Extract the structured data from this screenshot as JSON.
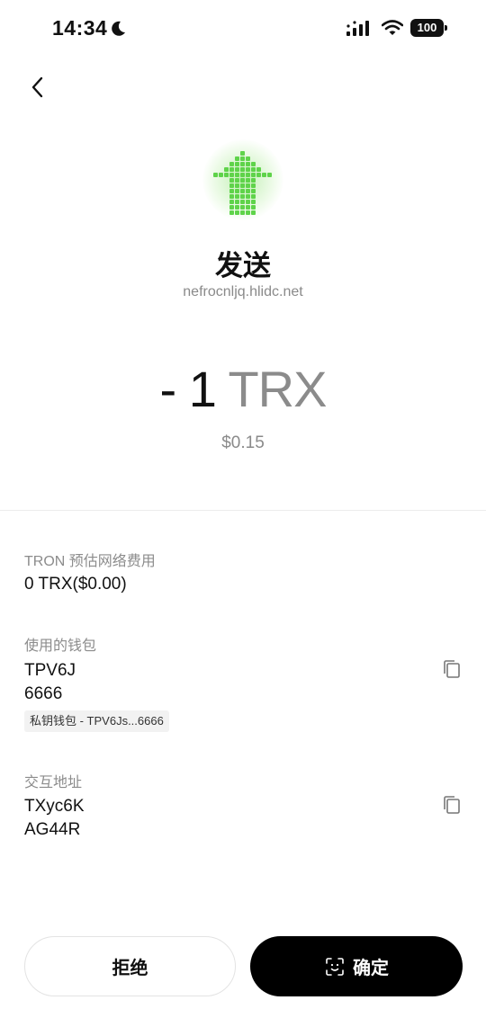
{
  "status_bar": {
    "time": "14:34",
    "battery": "100"
  },
  "transaction": {
    "type": "发送",
    "dapp_domain": "nefrocnljq.hlidc.net",
    "amount_value": "- 1",
    "amount_unit": "TRX",
    "fiat_value": "$0.15"
  },
  "fee": {
    "label": "TRON 预估网络费用",
    "value": "0 TRX($0.00)"
  },
  "wallet": {
    "label": "使用的钱包",
    "address_line1": "TPV6J",
    "address_line2": "6666",
    "tag": "私钥钱包 - TPV6Js...6666"
  },
  "interaction": {
    "label": "交互地址",
    "address_line1": "TXyc6K",
    "address_line2": "AG44R"
  },
  "actions": {
    "reject_label": "拒绝",
    "confirm_label": "确定"
  },
  "colors": {
    "accent_green": "#5fd34a",
    "confirm_bg": "#000000"
  }
}
